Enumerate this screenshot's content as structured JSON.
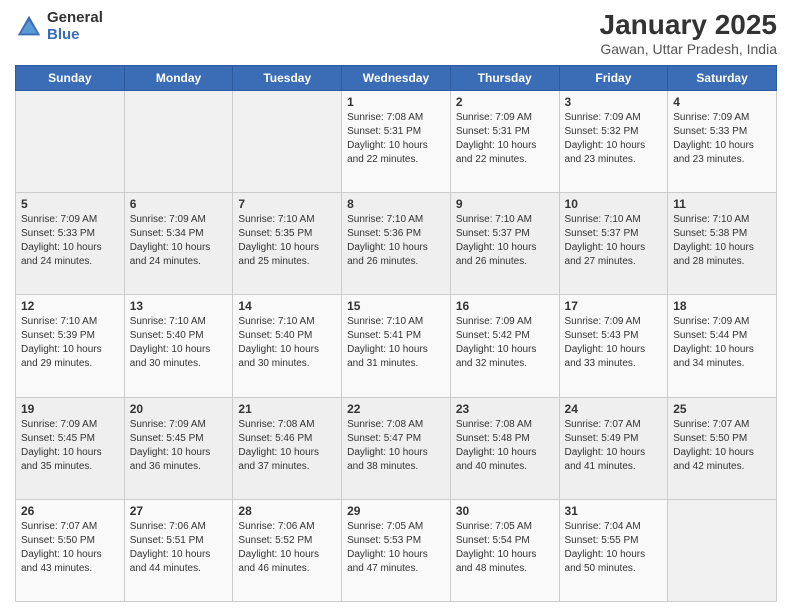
{
  "logo": {
    "general": "General",
    "blue": "Blue"
  },
  "header": {
    "month": "January 2025",
    "location": "Gawan, Uttar Pradesh, India"
  },
  "days_of_week": [
    "Sunday",
    "Monday",
    "Tuesday",
    "Wednesday",
    "Thursday",
    "Friday",
    "Saturday"
  ],
  "weeks": [
    [
      {
        "num": "",
        "sunrise": "",
        "sunset": "",
        "daylight": ""
      },
      {
        "num": "",
        "sunrise": "",
        "sunset": "",
        "daylight": ""
      },
      {
        "num": "",
        "sunrise": "",
        "sunset": "",
        "daylight": ""
      },
      {
        "num": "1",
        "sunrise": "Sunrise: 7:08 AM",
        "sunset": "Sunset: 5:31 PM",
        "daylight": "Daylight: 10 hours and 22 minutes."
      },
      {
        "num": "2",
        "sunrise": "Sunrise: 7:09 AM",
        "sunset": "Sunset: 5:31 PM",
        "daylight": "Daylight: 10 hours and 22 minutes."
      },
      {
        "num": "3",
        "sunrise": "Sunrise: 7:09 AM",
        "sunset": "Sunset: 5:32 PM",
        "daylight": "Daylight: 10 hours and 23 minutes."
      },
      {
        "num": "4",
        "sunrise": "Sunrise: 7:09 AM",
        "sunset": "Sunset: 5:33 PM",
        "daylight": "Daylight: 10 hours and 23 minutes."
      }
    ],
    [
      {
        "num": "5",
        "sunrise": "Sunrise: 7:09 AM",
        "sunset": "Sunset: 5:33 PM",
        "daylight": "Daylight: 10 hours and 24 minutes."
      },
      {
        "num": "6",
        "sunrise": "Sunrise: 7:09 AM",
        "sunset": "Sunset: 5:34 PM",
        "daylight": "Daylight: 10 hours and 24 minutes."
      },
      {
        "num": "7",
        "sunrise": "Sunrise: 7:10 AM",
        "sunset": "Sunset: 5:35 PM",
        "daylight": "Daylight: 10 hours and 25 minutes."
      },
      {
        "num": "8",
        "sunrise": "Sunrise: 7:10 AM",
        "sunset": "Sunset: 5:36 PM",
        "daylight": "Daylight: 10 hours and 26 minutes."
      },
      {
        "num": "9",
        "sunrise": "Sunrise: 7:10 AM",
        "sunset": "Sunset: 5:37 PM",
        "daylight": "Daylight: 10 hours and 26 minutes."
      },
      {
        "num": "10",
        "sunrise": "Sunrise: 7:10 AM",
        "sunset": "Sunset: 5:37 PM",
        "daylight": "Daylight: 10 hours and 27 minutes."
      },
      {
        "num": "11",
        "sunrise": "Sunrise: 7:10 AM",
        "sunset": "Sunset: 5:38 PM",
        "daylight": "Daylight: 10 hours and 28 minutes."
      }
    ],
    [
      {
        "num": "12",
        "sunrise": "Sunrise: 7:10 AM",
        "sunset": "Sunset: 5:39 PM",
        "daylight": "Daylight: 10 hours and 29 minutes."
      },
      {
        "num": "13",
        "sunrise": "Sunrise: 7:10 AM",
        "sunset": "Sunset: 5:40 PM",
        "daylight": "Daylight: 10 hours and 30 minutes."
      },
      {
        "num": "14",
        "sunrise": "Sunrise: 7:10 AM",
        "sunset": "Sunset: 5:40 PM",
        "daylight": "Daylight: 10 hours and 30 minutes."
      },
      {
        "num": "15",
        "sunrise": "Sunrise: 7:10 AM",
        "sunset": "Sunset: 5:41 PM",
        "daylight": "Daylight: 10 hours and 31 minutes."
      },
      {
        "num": "16",
        "sunrise": "Sunrise: 7:09 AM",
        "sunset": "Sunset: 5:42 PM",
        "daylight": "Daylight: 10 hours and 32 minutes."
      },
      {
        "num": "17",
        "sunrise": "Sunrise: 7:09 AM",
        "sunset": "Sunset: 5:43 PM",
        "daylight": "Daylight: 10 hours and 33 minutes."
      },
      {
        "num": "18",
        "sunrise": "Sunrise: 7:09 AM",
        "sunset": "Sunset: 5:44 PM",
        "daylight": "Daylight: 10 hours and 34 minutes."
      }
    ],
    [
      {
        "num": "19",
        "sunrise": "Sunrise: 7:09 AM",
        "sunset": "Sunset: 5:45 PM",
        "daylight": "Daylight: 10 hours and 35 minutes."
      },
      {
        "num": "20",
        "sunrise": "Sunrise: 7:09 AM",
        "sunset": "Sunset: 5:45 PM",
        "daylight": "Daylight: 10 hours and 36 minutes."
      },
      {
        "num": "21",
        "sunrise": "Sunrise: 7:08 AM",
        "sunset": "Sunset: 5:46 PM",
        "daylight": "Daylight: 10 hours and 37 minutes."
      },
      {
        "num": "22",
        "sunrise": "Sunrise: 7:08 AM",
        "sunset": "Sunset: 5:47 PM",
        "daylight": "Daylight: 10 hours and 38 minutes."
      },
      {
        "num": "23",
        "sunrise": "Sunrise: 7:08 AM",
        "sunset": "Sunset: 5:48 PM",
        "daylight": "Daylight: 10 hours and 40 minutes."
      },
      {
        "num": "24",
        "sunrise": "Sunrise: 7:07 AM",
        "sunset": "Sunset: 5:49 PM",
        "daylight": "Daylight: 10 hours and 41 minutes."
      },
      {
        "num": "25",
        "sunrise": "Sunrise: 7:07 AM",
        "sunset": "Sunset: 5:50 PM",
        "daylight": "Daylight: 10 hours and 42 minutes."
      }
    ],
    [
      {
        "num": "26",
        "sunrise": "Sunrise: 7:07 AM",
        "sunset": "Sunset: 5:50 PM",
        "daylight": "Daylight: 10 hours and 43 minutes."
      },
      {
        "num": "27",
        "sunrise": "Sunrise: 7:06 AM",
        "sunset": "Sunset: 5:51 PM",
        "daylight": "Daylight: 10 hours and 44 minutes."
      },
      {
        "num": "28",
        "sunrise": "Sunrise: 7:06 AM",
        "sunset": "Sunset: 5:52 PM",
        "daylight": "Daylight: 10 hours and 46 minutes."
      },
      {
        "num": "29",
        "sunrise": "Sunrise: 7:05 AM",
        "sunset": "Sunset: 5:53 PM",
        "daylight": "Daylight: 10 hours and 47 minutes."
      },
      {
        "num": "30",
        "sunrise": "Sunrise: 7:05 AM",
        "sunset": "Sunset: 5:54 PM",
        "daylight": "Daylight: 10 hours and 48 minutes."
      },
      {
        "num": "31",
        "sunrise": "Sunrise: 7:04 AM",
        "sunset": "Sunset: 5:55 PM",
        "daylight": "Daylight: 10 hours and 50 minutes."
      },
      {
        "num": "",
        "sunrise": "",
        "sunset": "",
        "daylight": ""
      }
    ]
  ]
}
